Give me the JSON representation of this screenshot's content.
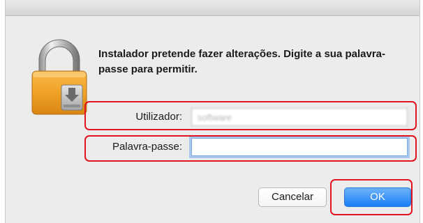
{
  "dialog": {
    "message": "Instalador pretende fazer alterações. Digite a sua palavra-passe para permitir.",
    "icon": "lock-icon",
    "fields": {
      "username_label": "Utilizador:",
      "username_value": "software",
      "password_label": "Palavra-passe:",
      "password_value": ""
    },
    "buttons": {
      "cancel_label": "Cancelar",
      "ok_label": "OK"
    },
    "colors": {
      "annotation": "#e0141e",
      "accent": "#1a7ef5",
      "focus_ring": "#a9c8ef"
    }
  }
}
